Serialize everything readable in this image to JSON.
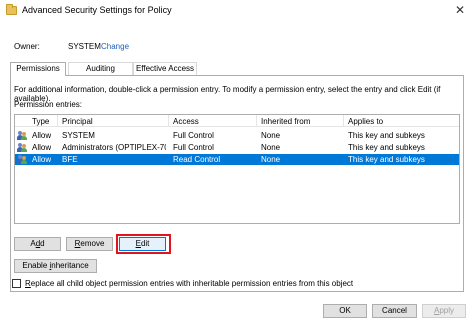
{
  "window": {
    "title": "Advanced Security Settings for Policy",
    "close_glyph": "✕"
  },
  "owner": {
    "label": "Owner:",
    "value": "SYSTEM",
    "change_link": "Change"
  },
  "tabs": [
    {
      "label": "Permissions",
      "active": true
    },
    {
      "label": "Auditing",
      "active": false
    },
    {
      "label": "Effective Access",
      "active": false
    }
  ],
  "info_text": "For additional information, double-click a permission entry. To modify a permission entry, select the entry and click Edit (if available).",
  "entries_label": "Permission entries:",
  "table": {
    "columns": [
      "Type",
      "Principal",
      "Access",
      "Inherited from",
      "Applies to"
    ],
    "rows": [
      {
        "type": "Allow",
        "principal": "SYSTEM",
        "access": "Full Control",
        "inherited": "None",
        "applies": "This key and subkeys",
        "selected": false
      },
      {
        "type": "Allow",
        "principal": "Administrators (OPTIPLEX-70...",
        "access": "Full Control",
        "inherited": "None",
        "applies": "This key and subkeys",
        "selected": false
      },
      {
        "type": "Allow",
        "principal": "BFE",
        "access": "Read Control",
        "inherited": "None",
        "applies": "This key and subkeys",
        "selected": true
      }
    ]
  },
  "buttons": {
    "add": {
      "pre": "A",
      "accel": "d",
      "post": "d"
    },
    "remove": {
      "pre": "",
      "accel": "R",
      "post": "emove"
    },
    "edit": {
      "pre": "",
      "accel": "E",
      "post": "dit"
    },
    "inheritance": {
      "pre": "Enable ",
      "accel": "i",
      "post": "nheritance"
    },
    "ok": "OK",
    "cancel": "Cancel",
    "apply": {
      "pre": "",
      "accel": "A",
      "post": "pply"
    }
  },
  "replace_checkbox": {
    "pre": "",
    "accel": "R",
    "post": "eplace all child object permission entries with inheritable permission entries from this object",
    "checked": false
  },
  "colors": {
    "selection": "#0078d7",
    "link": "#1f5fbf",
    "highlight_box": "#e0141e"
  },
  "icons": {
    "title": "folder-icon",
    "principal": "user-group-icon"
  }
}
